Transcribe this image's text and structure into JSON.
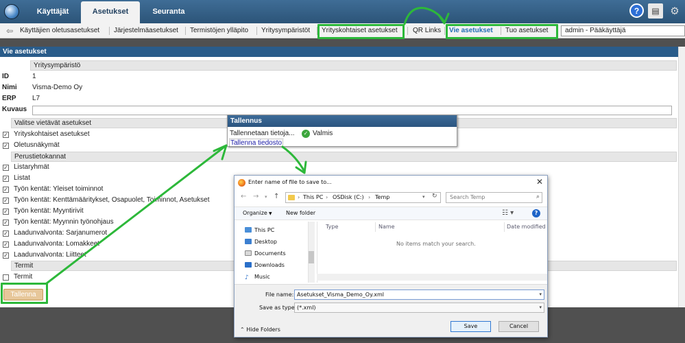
{
  "main_tabs": [
    {
      "label": "Käyttäjät"
    },
    {
      "label": "Asetukset"
    },
    {
      "label": "Seuranta"
    }
  ],
  "subnav": {
    "items": [
      {
        "label": "Käyttäjien oletusasetukset"
      },
      {
        "label": "Järjestelmäasetukset"
      },
      {
        "label": "Termistöjen ylläpito"
      },
      {
        "label": "Yritysympäristöt"
      },
      {
        "label": "Yrityskohtaiset asetukset"
      },
      {
        "label": "QR Links"
      },
      {
        "label": "Vie asetukset"
      },
      {
        "label": "Tuo asetukset"
      }
    ],
    "user": "admin - Pääkäyttäjä"
  },
  "panel": {
    "title": "Vie asetukset",
    "env_header": "Yritysympäristö",
    "fields": [
      {
        "label": "ID",
        "value": "1"
      },
      {
        "label": "Nimi",
        "value": "Visma-Demo Oy"
      },
      {
        "label": "ERP",
        "value": "L7"
      },
      {
        "label": "Kuvaus",
        "value": ""
      }
    ],
    "section_select": "Valitse vietävät asetukset",
    "section_base": "Perustietokannat",
    "section_terms": "Termit",
    "checkboxes_select": [
      {
        "label": "Yrityskohtaiset asetukset",
        "checked": true
      },
      {
        "label": "Oletusnäkymät",
        "checked": true
      }
    ],
    "checkboxes_base": [
      {
        "label": "Listaryhmät",
        "checked": true
      },
      {
        "label": "Listat",
        "checked": true
      },
      {
        "label": "Työn kentät: Yleiset toiminnot",
        "checked": true
      },
      {
        "label": "Työn kentät: Kenttämääritykset, Osapuolet, Toiminnot, Asetukset",
        "checked": true
      },
      {
        "label": "Työn kentät: Myyntirivit",
        "checked": true
      },
      {
        "label": "Työn kentät: Myynnin työnohjaus",
        "checked": true
      },
      {
        "label": "Laadunvalvonta: Sarjanumerot",
        "checked": true
      },
      {
        "label": "Laadunvalvonta: Lomakkeet",
        "checked": true
      },
      {
        "label": "Laadunvalvonta: Liitteet",
        "checked": true
      }
    ],
    "checkboxes_terms": [
      {
        "label": "Termit",
        "checked": false
      }
    ],
    "save_label": "Tallenna"
  },
  "popup": {
    "title": "Tallennus",
    "status": "Tallennetaan tietoja...",
    "done": "Valmis",
    "link": "Tallenna tiedosto"
  },
  "dialog": {
    "title": "Enter name of file to save to...",
    "path": [
      "This PC",
      "OSDisk (C:)",
      "Temp"
    ],
    "search_placeholder": "Search Temp",
    "organize": "Organize",
    "new_folder": "New folder",
    "tree": [
      {
        "label": "This PC",
        "icon": "computer-icon"
      },
      {
        "label": "Desktop",
        "icon": "desktop-icon"
      },
      {
        "label": "Documents",
        "icon": "documents-icon"
      },
      {
        "label": "Downloads",
        "icon": "downloads-icon"
      },
      {
        "label": "Music",
        "icon": "music-icon"
      }
    ],
    "columns": [
      "Type",
      "Name",
      "Date modified"
    ],
    "empty_message": "No items match your search.",
    "file_name_label": "File name:",
    "file_name": "Asetukset_Visma_Demo_Oy.xml",
    "save_type_label": "Save as type:",
    "save_type": "(*.xml)",
    "hide_folders": "Hide Folders",
    "save": "Save",
    "cancel": "Cancel"
  },
  "colors": {
    "annotation_green": "#2db83a",
    "header_blue": "#2a5c8a",
    "active_link": "#1e6db4"
  }
}
